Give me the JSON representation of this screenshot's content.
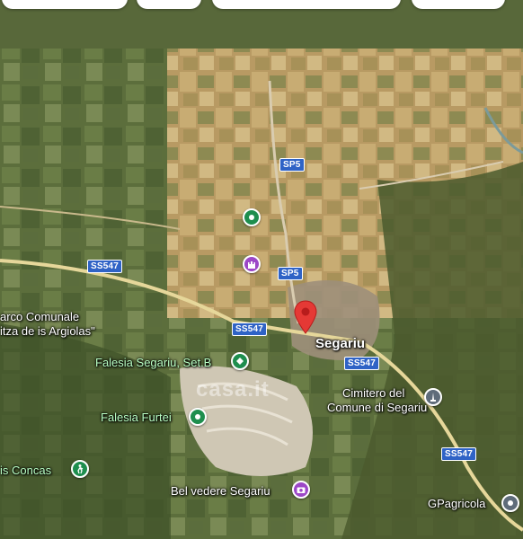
{
  "map": {
    "watermark": "casa.it",
    "roads": [
      {
        "id": "sp5-north",
        "label": "SP5"
      },
      {
        "id": "sp5-south",
        "label": "SP5"
      },
      {
        "id": "ss547-west",
        "label": "SS547"
      },
      {
        "id": "ss547-center",
        "label": "SS547"
      },
      {
        "id": "ss547-east",
        "label": "SS547"
      },
      {
        "id": "ss547-southeast",
        "label": "SS547"
      }
    ],
    "places": [
      {
        "id": "parco",
        "line1": "arco Comunale",
        "line2": "itza de is Argiolas\""
      },
      {
        "id": "falesia-setb",
        "label": "Falesia Segariu, Set.B"
      },
      {
        "id": "falesia-furtei",
        "label": "Falesia Furtei"
      },
      {
        "id": "concas",
        "label": "is Concas"
      },
      {
        "id": "belvedere",
        "label": "Bel vedere Segariu"
      },
      {
        "id": "town",
        "label": "Segariu"
      },
      {
        "id": "cimitero",
        "line1": "Cimitero del",
        "line2": "Comune di Segariu"
      },
      {
        "id": "gpagricola",
        "label": "GPagricola"
      }
    ],
    "icons": [
      "green-place-icon",
      "purple-castle-icon",
      "green-climbing-icon",
      "green-place-icon",
      "green-hiking-icon",
      "purple-camera-icon",
      "gray-monument-icon",
      "gray-pin-icon",
      "red-location-pin-icon"
    ]
  }
}
